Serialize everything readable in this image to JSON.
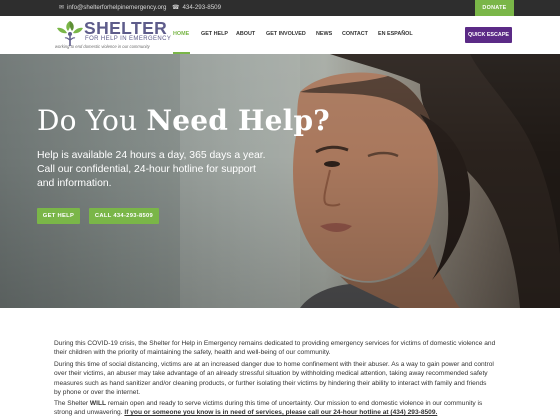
{
  "topbar": {
    "email": "info@shelterforhelpinemergency.org",
    "phone": "434-293-8509",
    "donate_label": "DONATE"
  },
  "logo": {
    "name": "SHELTER",
    "subtitle": "FOR HELP IN EMERGENCY",
    "tagline": "working to end domestic violence in our community"
  },
  "nav": {
    "items": [
      "HOME",
      "GET HELP",
      "ABOUT",
      "GET INVOLVED",
      "NEWS",
      "CONTACT",
      "EN ESPAÑOL"
    ],
    "active": "HOME",
    "quick_escape_label": "QUICK ESCAPE"
  },
  "hero": {
    "title_light": "Do You",
    "title_bold": "Need Help?",
    "lines": [
      "Help is available 24 hours a day, 365 days a year.",
      "Call our confidential, 24-hour hotline for support",
      "and information."
    ],
    "get_help_label": "GET HELP",
    "call_label": "CALL 434-293-8509"
  },
  "content": {
    "p1": [
      "During this COVID-19 crisis, the Shelter for Help in Emergency remains dedicated to providing emergency services for victims of domestic violence and",
      "their children with the priority of maintaining the safety, health and well-being of our community."
    ],
    "p2": [
      "During this time of social distancing, victims are at an increased danger due to home confinement with their abuser.  As a way to gain power and control",
      "over their victims, an abuser may take advantage of an already stressful situation by withholding medical attention, taking away recommended safety",
      "measures such as hand sanitizer and/or cleaning products, or further isolating their victims by hindering their ability to interact with family and friends",
      "by phone or over the internet."
    ],
    "p3_a_pre": "The Shelter ",
    "p3_a_bold": "WILL",
    "p3_a_post": " remain open and ready to serve victims during this time of uncertainty.  Our mission to end domestic violence in our community is",
    "p3_b_pre": "strong and unwavering.  ",
    "p3_b_highlight": "If you or someone you know is in need of services, please call our 24-hour hotline at (434) 293-8509."
  },
  "colors": {
    "brand_purple": "#5e5c8b",
    "quick_escape": "#5b2a86",
    "accent_green": "#7ab648",
    "topbar": "#2e2e2e"
  },
  "icons": [
    "envelope-icon",
    "phone-icon",
    "leaf-people-logo-icon"
  ]
}
